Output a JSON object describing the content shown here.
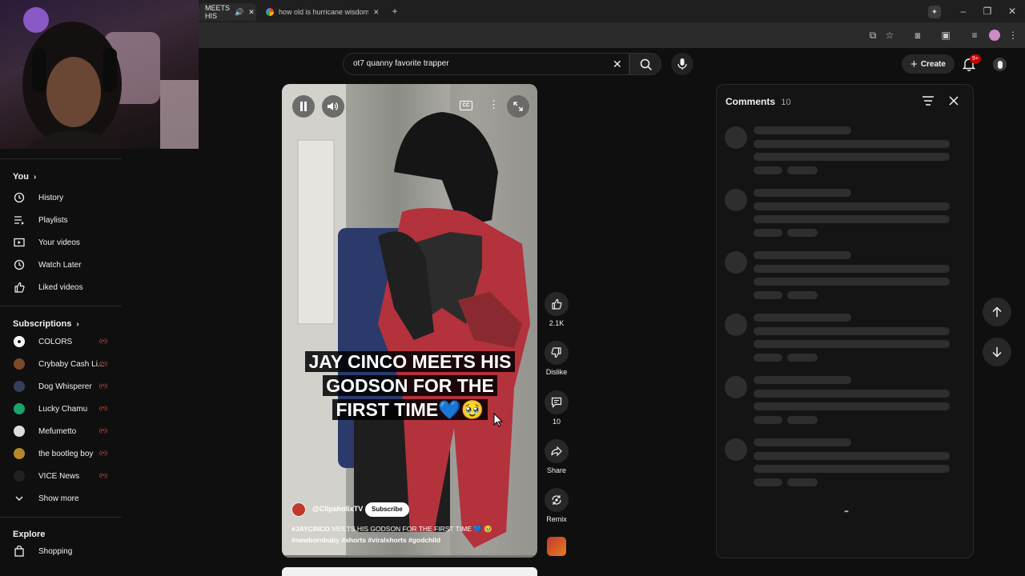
{
  "browser": {
    "tabs": [
      {
        "title": "MEETS HIS"
      },
      {
        "title": "how old is hurricane wisdom - "
      }
    ]
  },
  "search": {
    "value": "ot7 quanny favorite trapper"
  },
  "header": {
    "create_label": "Create",
    "notifications_badge": "9+"
  },
  "sidebar": {
    "you_title": "You",
    "you_items": [
      {
        "label": "History",
        "icon": "history-icon"
      },
      {
        "label": "Playlists",
        "icon": "playlists-icon"
      },
      {
        "label": "Your videos",
        "icon": "your-videos-icon"
      },
      {
        "label": "Watch Later",
        "icon": "watch-later-icon"
      },
      {
        "label": "Liked videos",
        "icon": "liked-videos-icon"
      }
    ],
    "subscriptions_title": "Subscriptions",
    "subscriptions": [
      {
        "label": "COLORS",
        "color": "#ffffff"
      },
      {
        "label": "Crybaby Cash Li...",
        "color": "#7a4a2a"
      },
      {
        "label": "Dog Whisperer",
        "color": "#34405a"
      },
      {
        "label": "Lucky Chamu",
        "color": "#1aa36a"
      },
      {
        "label": "Mefumetto",
        "color": "#dddddd"
      },
      {
        "label": "the bootleg boy",
        "color": "#b8862b"
      },
      {
        "label": "VICE News",
        "color": "#222222"
      }
    ],
    "show_more": "Show more",
    "explore_title": "Explore",
    "explore_items": [
      {
        "label": "Shopping",
        "icon": "shopping-icon"
      }
    ]
  },
  "video": {
    "caption": "JAY CINCO MEETS HIS GODSON FOR THE FIRST TIME💙🥹",
    "channel": "@ClipaholixTV",
    "subscribe": "Subscribe",
    "description_line1_tag": "#JAYCINCO",
    "description_line1_rest": " MEETS HIS GODSON FOR THE FIRST TIME 💙 🥹",
    "description_line2": "#newbornbaby #shorts #viralshorts #godchild",
    "cc": "CC"
  },
  "actions": {
    "like_count": "2.1K",
    "dislike_label": "Dislike",
    "comment_count": "10",
    "share_label": "Share",
    "remix_label": "Remix"
  },
  "comments": {
    "title": "Comments",
    "count": "10"
  },
  "colors": {
    "live_badge": "#ff4e45",
    "notification_badge": "#cc0000"
  }
}
